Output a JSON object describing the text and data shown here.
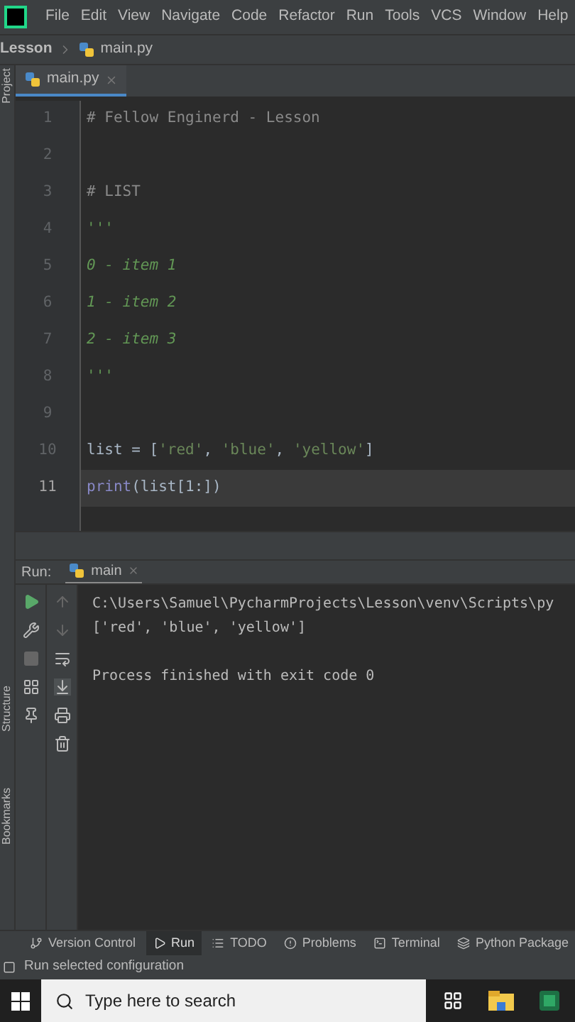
{
  "menu": [
    {
      "label": "File"
    },
    {
      "label": "Edit"
    },
    {
      "label": "View"
    },
    {
      "label": "Navigate"
    },
    {
      "label": "Code"
    },
    {
      "label": "Refactor"
    },
    {
      "label": "Run"
    },
    {
      "label": "Tools"
    },
    {
      "label": "VCS"
    },
    {
      "label": "Window"
    },
    {
      "label": "Help"
    }
  ],
  "breadcrumb": {
    "project": "Lesson",
    "file": "main.py"
  },
  "tabs": [
    {
      "label": "main.py",
      "selected": true
    }
  ],
  "side_labels": {
    "top": "Project",
    "middle": "Structure",
    "bottom": "Bookmarks"
  },
  "editor": {
    "lines": [
      {
        "number": "1",
        "current": false,
        "tokens": [
          {
            "kind": "comment",
            "text": "# Fellow Enginerd - Lesson"
          }
        ]
      },
      {
        "number": "2",
        "current": false
      },
      {
        "number": "3",
        "current": false,
        "tokens": [
          {
            "kind": "comment",
            "text": "# LIST"
          }
        ]
      },
      {
        "number": "4",
        "current": false,
        "tokens": [
          {
            "kind": "docstring",
            "text": "'''"
          }
        ]
      },
      {
        "number": "5",
        "current": false,
        "tokens": [
          {
            "kind": "docstring",
            "text": "0 - item 1"
          }
        ]
      },
      {
        "number": "6",
        "current": false,
        "tokens": [
          {
            "kind": "docstring",
            "text": "1 - item 2"
          }
        ]
      },
      {
        "number": "7",
        "current": false,
        "tokens": [
          {
            "kind": "docstring",
            "text": "2 - item 3"
          }
        ]
      },
      {
        "number": "8",
        "current": false,
        "tokens": [
          {
            "kind": "docstring",
            "text": "'''"
          }
        ]
      },
      {
        "number": "9",
        "current": false
      },
      {
        "number": "10",
        "current": false,
        "tokens": [
          {
            "kind": "plain",
            "text": "list = ["
          },
          {
            "kind": "string",
            "text": "'red'"
          },
          {
            "kind": "plain",
            "text": ", "
          },
          {
            "kind": "string",
            "text": "'blue'"
          },
          {
            "kind": "plain",
            "text": ", "
          },
          {
            "kind": "string",
            "text": "'yellow'"
          },
          {
            "kind": "plain",
            "text": "]"
          }
        ]
      },
      {
        "number": "11",
        "current": true,
        "tokens": [
          {
            "kind": "builtin",
            "text": "print"
          },
          {
            "kind": "plain",
            "text": "(list[1:])"
          }
        ]
      }
    ]
  },
  "run_panel": {
    "label": "Run:",
    "tab": "main",
    "command": "C:\\Users\\Samuel\\PycharmProjects\\Lesson\\venv\\Scripts\\py",
    "result": "['red', 'blue', 'yellow']",
    "exit_message": "Process finished with exit code 0"
  },
  "tool_windows": [
    {
      "label": "Version Control",
      "selected": false
    },
    {
      "label": "Run",
      "selected": true
    },
    {
      "label": "TODO",
      "selected": false
    },
    {
      "label": "Problems",
      "selected": false
    },
    {
      "label": "Terminal",
      "selected": false
    },
    {
      "label": "Python Package",
      "selected": false
    }
  ],
  "status_bar": {
    "text": "Run selected configuration"
  },
  "taskbar": {
    "search": {
      "placeholder": "Type here to search"
    }
  }
}
